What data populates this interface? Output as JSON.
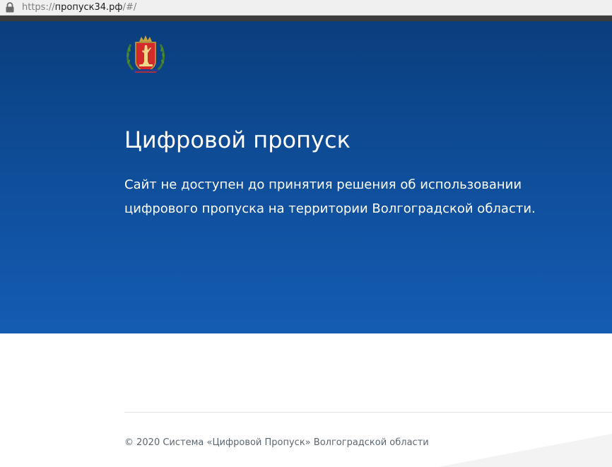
{
  "browser": {
    "url_scheme": "https://",
    "url_host": "пропуск34.рф",
    "url_path": "/#/",
    "lock_icon": "lock-icon"
  },
  "hero": {
    "emblem_icon": "volgograd-oblast-coat-of-arms",
    "title": "Цифровой пропуск",
    "description": "Сайт не доступен до принятия решения об использовании цифрового пропуска на территории Волгоградской области."
  },
  "footer": {
    "copyright": "© 2020 Система «Цифровой Пропуск» Волгоградской области"
  },
  "colors": {
    "hero_top": "#0a3e7d",
    "hero_bottom": "#145cb3",
    "footer_text": "#5c6670",
    "emblem_red": "#d32a2a",
    "emblem_gold": "#c8a23a"
  }
}
